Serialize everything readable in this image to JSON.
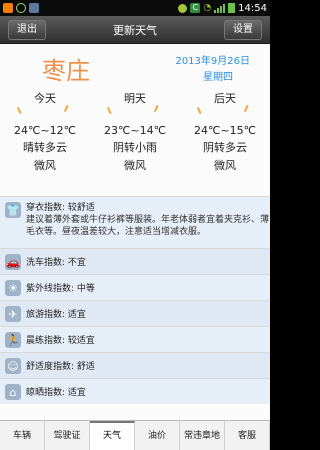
{
  "status_bar": {
    "time": "14:54",
    "icons": [
      "app-icon",
      "recycle-icon",
      "photo-icon",
      "android-icon",
      "c-icon",
      "wifi-icon",
      "signal-icon",
      "battery-icon"
    ]
  },
  "title_bar": {
    "back_label": "退出",
    "title": "更新天气",
    "settings_label": "设置"
  },
  "header": {
    "city": "枣庄",
    "date": "2013年9月26日",
    "weekday": "星期四"
  },
  "days": [
    {
      "name": "今天",
      "temp": "24℃~12℃",
      "condition": "晴转多云",
      "wind": "微风",
      "icon": "sunny-icon"
    },
    {
      "name": "明天",
      "temp": "23℃~14℃",
      "condition": "阴转小雨",
      "wind": "微风",
      "icon": "rain-icon"
    },
    {
      "name": "后天",
      "temp": "24℃~15℃",
      "condition": "阴转多云",
      "wind": "微风",
      "icon": "cloudy-icon"
    }
  ],
  "indices": [
    {
      "title": "穿衣指数: 较舒适",
      "desc": "建议着薄外套或牛仔衫裤等服装。年老体弱者宜着夹克衫、薄毛衣等。昼夜温差较大，注意适当增减衣服。",
      "icon": "shirt-icon"
    },
    {
      "title": "洗车指数: 不宜",
      "icon": "car-icon"
    },
    {
      "title": "紫外线指数: 中等",
      "icon": "uv-icon"
    },
    {
      "title": "旅游指数: 适宜",
      "icon": "plane-icon"
    },
    {
      "title": "晨练指数: 较适宜",
      "icon": "exercise-icon"
    },
    {
      "title": "舒适度指数: 舒适",
      "icon": "smile-icon"
    },
    {
      "title": "晾晒指数: 适宜",
      "icon": "hanger-icon"
    }
  ],
  "tabs": [
    {
      "label": "车辆",
      "active": false
    },
    {
      "label": "驾驶证",
      "active": false
    },
    {
      "label": "天气",
      "active": true
    },
    {
      "label": "油价",
      "active": false
    },
    {
      "label": "常违章地",
      "active": false
    },
    {
      "label": "客服",
      "active": false
    }
  ],
  "colors": {
    "city": "#f0904a",
    "date": "#2a8fe0",
    "title_bar": "#3a3a3a"
  }
}
